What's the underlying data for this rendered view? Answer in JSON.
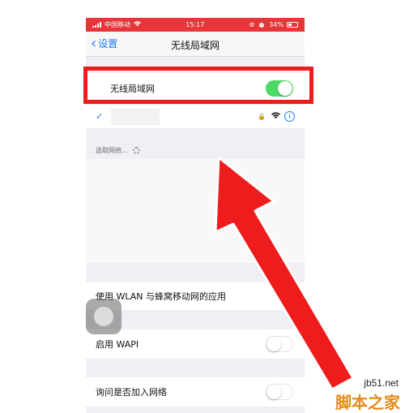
{
  "status_bar": {
    "carrier": "中国移动",
    "time": "15:17",
    "battery": "34%"
  },
  "nav": {
    "back_label": "设置",
    "title": "无线局域网"
  },
  "wifi_toggle": {
    "label": "无线局域网",
    "on": true
  },
  "choose_network": {
    "label": "选取网络..."
  },
  "settings": {
    "wlan_apps": "使用 WLAN 与蜂窝移动网的应用",
    "wapi": {
      "label": "启用 WAPI",
      "on": false
    },
    "ask_join": {
      "label": "询问是否加入网络",
      "on": false
    }
  },
  "watermark": {
    "url": "jb51.net",
    "name": "脚本之家"
  },
  "colors": {
    "accent": "#1a7ef3",
    "toggle_on": "#4cd964",
    "annotation_red": "#ee1c1c",
    "statusbar_red": "#e8353a"
  }
}
